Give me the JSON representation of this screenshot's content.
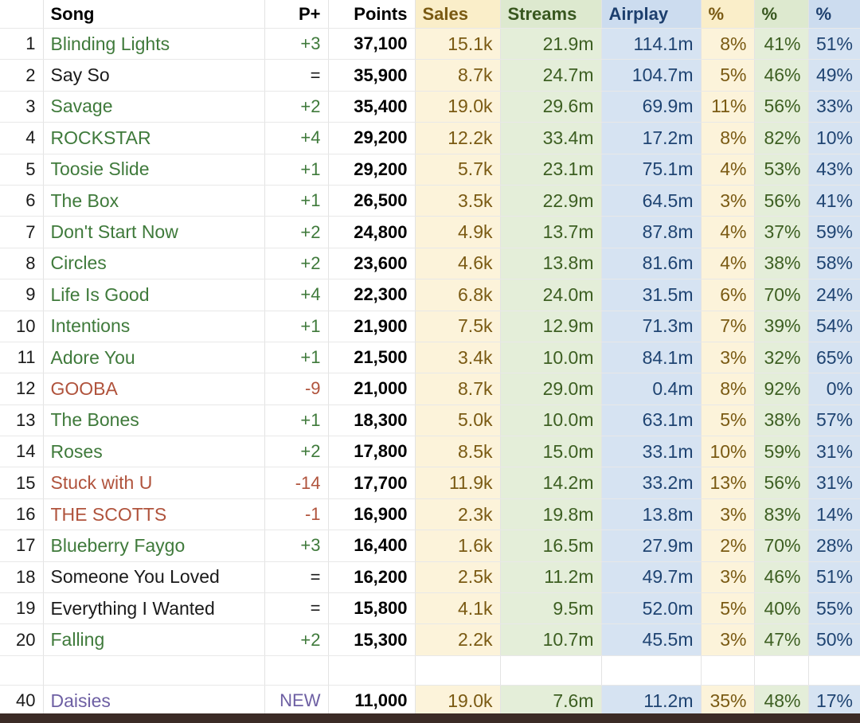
{
  "table": {
    "headers": {
      "rank": "",
      "song": "Song",
      "pp": "P+",
      "points": "Points",
      "sales": "Sales",
      "streams": "Streams",
      "airplay": "Airplay",
      "pct1": "%",
      "pct2": "%",
      "pct3": "%"
    },
    "colors": {
      "sales_bg": "#fcf3da",
      "sales_text": "#7a5a13",
      "streams_bg": "#e4eed9",
      "streams_text": "#3d5f22",
      "airplay_bg": "#d6e3f2",
      "airplay_text": "#1f4472",
      "up": "#3f7a3b",
      "down": "#b0533c",
      "same": "#1a1a1a",
      "new": "#6d5fa3",
      "bottom_bar": "#3b2b26"
    },
    "rows": [
      {
        "rank": "1",
        "song": "Blinding Lights",
        "trend": "up",
        "pp": "+3",
        "points": "37,100",
        "sales": "15.1k",
        "streams": "21.9m",
        "airplay": "114.1m",
        "pct1": "8%",
        "pct2": "41%",
        "pct3": "51%"
      },
      {
        "rank": "2",
        "song": "Say So",
        "trend": "same",
        "pp": "=",
        "points": "35,900",
        "sales": "8.7k",
        "streams": "24.7m",
        "airplay": "104.7m",
        "pct1": "5%",
        "pct2": "46%",
        "pct3": "49%"
      },
      {
        "rank": "3",
        "song": "Savage",
        "trend": "up",
        "pp": "+2",
        "points": "35,400",
        "sales": "19.0k",
        "streams": "29.6m",
        "airplay": "69.9m",
        "pct1": "11%",
        "pct2": "56%",
        "pct3": "33%"
      },
      {
        "rank": "4",
        "song": "ROCKSTAR",
        "trend": "up",
        "pp": "+4",
        "points": "29,200",
        "sales": "12.2k",
        "streams": "33.4m",
        "airplay": "17.2m",
        "pct1": "8%",
        "pct2": "82%",
        "pct3": "10%"
      },
      {
        "rank": "5",
        "song": "Toosie Slide",
        "trend": "up",
        "pp": "+1",
        "points": "29,200",
        "sales": "5.7k",
        "streams": "23.1m",
        "airplay": "75.1m",
        "pct1": "4%",
        "pct2": "53%",
        "pct3": "43%"
      },
      {
        "rank": "6",
        "song": "The Box",
        "trend": "up",
        "pp": "+1",
        "points": "26,500",
        "sales": "3.5k",
        "streams": "22.9m",
        "airplay": "64.5m",
        "pct1": "3%",
        "pct2": "56%",
        "pct3": "41%"
      },
      {
        "rank": "7",
        "song": "Don't Start Now",
        "trend": "up",
        "pp": "+2",
        "points": "24,800",
        "sales": "4.9k",
        "streams": "13.7m",
        "airplay": "87.8m",
        "pct1": "4%",
        "pct2": "37%",
        "pct3": "59%"
      },
      {
        "rank": "8",
        "song": "Circles",
        "trend": "up",
        "pp": "+2",
        "points": "23,600",
        "sales": "4.6k",
        "streams": "13.8m",
        "airplay": "81.6m",
        "pct1": "4%",
        "pct2": "38%",
        "pct3": "58%"
      },
      {
        "rank": "9",
        "song": "Life Is Good",
        "trend": "up",
        "pp": "+4",
        "points": "22,300",
        "sales": "6.8k",
        "streams": "24.0m",
        "airplay": "31.5m",
        "pct1": "6%",
        "pct2": "70%",
        "pct3": "24%"
      },
      {
        "rank": "10",
        "song": "Intentions",
        "trend": "up",
        "pp": "+1",
        "points": "21,900",
        "sales": "7.5k",
        "streams": "12.9m",
        "airplay": "71.3m",
        "pct1": "7%",
        "pct2": "39%",
        "pct3": "54%"
      },
      {
        "rank": "11",
        "song": "Adore You",
        "trend": "up",
        "pp": "+1",
        "points": "21,500",
        "sales": "3.4k",
        "streams": "10.0m",
        "airplay": "84.1m",
        "pct1": "3%",
        "pct2": "32%",
        "pct3": "65%"
      },
      {
        "rank": "12",
        "song": "GOOBA",
        "trend": "down",
        "pp": "-9",
        "points": "21,000",
        "sales": "8.7k",
        "streams": "29.0m",
        "airplay": "0.4m",
        "pct1": "8%",
        "pct2": "92%",
        "pct3": "0%"
      },
      {
        "rank": "13",
        "song": "The Bones",
        "trend": "up",
        "pp": "+1",
        "points": "18,300",
        "sales": "5.0k",
        "streams": "10.0m",
        "airplay": "63.1m",
        "pct1": "5%",
        "pct2": "38%",
        "pct3": "57%"
      },
      {
        "rank": "14",
        "song": "Roses",
        "trend": "up",
        "pp": "+2",
        "points": "17,800",
        "sales": "8.5k",
        "streams": "15.0m",
        "airplay": "33.1m",
        "pct1": "10%",
        "pct2": "59%",
        "pct3": "31%"
      },
      {
        "rank": "15",
        "song": "Stuck with U",
        "trend": "down",
        "pp": "-14",
        "points": "17,700",
        "sales": "11.9k",
        "streams": "14.2m",
        "airplay": "33.2m",
        "pct1": "13%",
        "pct2": "56%",
        "pct3": "31%"
      },
      {
        "rank": "16",
        "song": "THE SCOTTS",
        "trend": "down",
        "pp": "-1",
        "points": "16,900",
        "sales": "2.3k",
        "streams": "19.8m",
        "airplay": "13.8m",
        "pct1": "3%",
        "pct2": "83%",
        "pct3": "14%"
      },
      {
        "rank": "17",
        "song": "Blueberry Faygo",
        "trend": "up",
        "pp": "+3",
        "points": "16,400",
        "sales": "1.6k",
        "streams": "16.5m",
        "airplay": "27.9m",
        "pct1": "2%",
        "pct2": "70%",
        "pct3": "28%"
      },
      {
        "rank": "18",
        "song": "Someone You Loved",
        "trend": "same",
        "pp": "=",
        "points": "16,200",
        "sales": "2.5k",
        "streams": "11.2m",
        "airplay": "49.7m",
        "pct1": "3%",
        "pct2": "46%",
        "pct3": "51%"
      },
      {
        "rank": "19",
        "song": "Everything I Wanted",
        "trend": "same",
        "pp": "=",
        "points": "15,800",
        "sales": "4.1k",
        "streams": "9.5m",
        "airplay": "52.0m",
        "pct1": "5%",
        "pct2": "40%",
        "pct3": "55%"
      },
      {
        "rank": "20",
        "song": "Falling",
        "trend": "up",
        "pp": "+2",
        "points": "15,300",
        "sales": "2.2k",
        "streams": "10.7m",
        "airplay": "45.5m",
        "pct1": "3%",
        "pct2": "47%",
        "pct3": "50%"
      },
      {
        "spacer": true,
        "rank": "",
        "song": "",
        "trend": "same",
        "pp": "",
        "points": "",
        "sales": "",
        "streams": "",
        "airplay": "",
        "pct1": "",
        "pct2": "",
        "pct3": ""
      },
      {
        "rank": "40",
        "song": "Daisies",
        "trend": "new",
        "pp": "NEW",
        "points": "11,000",
        "sales": "19.0k",
        "streams": "7.6m",
        "airplay": "11.2m",
        "pct1": "35%",
        "pct2": "48%",
        "pct3": "17%"
      }
    ]
  }
}
